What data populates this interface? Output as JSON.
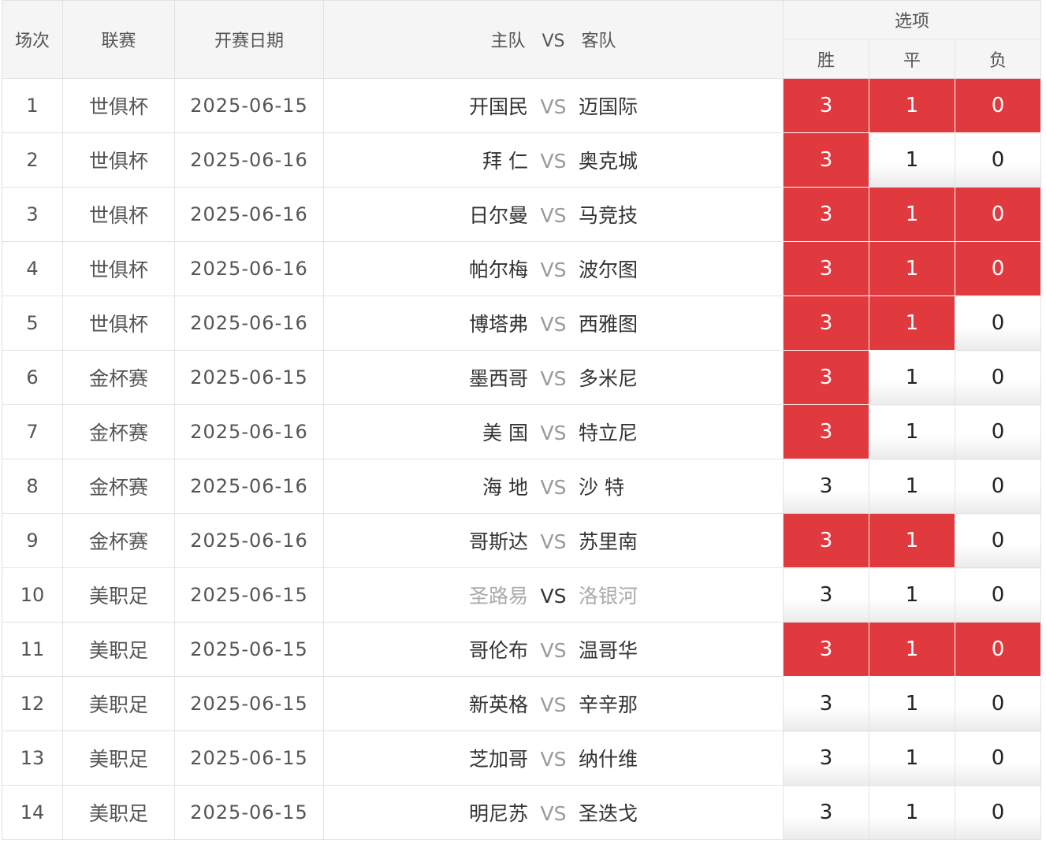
{
  "header": {
    "col_index": "场次",
    "col_league": "联赛",
    "col_date": "开赛日期",
    "col_home": "主队",
    "col_vs": "VS",
    "col_away": "客队",
    "col_options": "选项",
    "opt_win": "胜",
    "opt_draw": "平",
    "opt_lose": "负"
  },
  "accent_color": "#e0393e",
  "rows": [
    {
      "no": "1",
      "league": "世俱杯",
      "date": "2025-06-15",
      "home": "开国民",
      "vs": "VS",
      "away": "迈国际",
      "win": "3",
      "draw": "1",
      "lose": "0",
      "sel": [
        true,
        true,
        true
      ]
    },
    {
      "no": "2",
      "league": "世俱杯",
      "date": "2025-06-16",
      "home": "拜 仁",
      "vs": "VS",
      "away": "奥克城",
      "win": "3",
      "draw": "1",
      "lose": "0",
      "sel": [
        true,
        false,
        false
      ]
    },
    {
      "no": "3",
      "league": "世俱杯",
      "date": "2025-06-16",
      "home": "日尔曼",
      "vs": "VS",
      "away": "马竞技",
      "win": "3",
      "draw": "1",
      "lose": "0",
      "sel": [
        true,
        true,
        true
      ]
    },
    {
      "no": "4",
      "league": "世俱杯",
      "date": "2025-06-16",
      "home": "帕尔梅",
      "vs": "VS",
      "away": "波尔图",
      "win": "3",
      "draw": "1",
      "lose": "0",
      "sel": [
        true,
        true,
        true
      ]
    },
    {
      "no": "5",
      "league": "世俱杯",
      "date": "2025-06-16",
      "home": "博塔弗",
      "vs": "VS",
      "away": "西雅图",
      "win": "3",
      "draw": "1",
      "lose": "0",
      "sel": [
        true,
        true,
        false
      ]
    },
    {
      "no": "6",
      "league": "金杯赛",
      "date": "2025-06-15",
      "home": "墨西哥",
      "vs": "VS",
      "away": "多米尼",
      "win": "3",
      "draw": "1",
      "lose": "0",
      "sel": [
        true,
        false,
        false
      ]
    },
    {
      "no": "7",
      "league": "金杯赛",
      "date": "2025-06-16",
      "home": "美 国",
      "vs": "VS",
      "away": "特立尼",
      "win": "3",
      "draw": "1",
      "lose": "0",
      "sel": [
        true,
        false,
        false
      ]
    },
    {
      "no": "8",
      "league": "金杯赛",
      "date": "2025-06-16",
      "home": "海 地",
      "vs": "VS",
      "away": "沙 特",
      "win": "3",
      "draw": "1",
      "lose": "0",
      "sel": [
        false,
        false,
        false
      ]
    },
    {
      "no": "9",
      "league": "金杯赛",
      "date": "2025-06-16",
      "home": "哥斯达",
      "vs": "VS",
      "away": "苏里南",
      "win": "3",
      "draw": "1",
      "lose": "0",
      "sel": [
        true,
        true,
        false
      ]
    },
    {
      "no": "10",
      "league": "美职足",
      "date": "2025-06-15",
      "home": "圣路易",
      "vs": "VS",
      "away": "洛银河",
      "win": "3",
      "draw": "1",
      "lose": "0",
      "sel": [
        false,
        false,
        false
      ],
      "muted": true
    },
    {
      "no": "11",
      "league": "美职足",
      "date": "2025-06-15",
      "home": "哥伦布",
      "vs": "VS",
      "away": "温哥华",
      "win": "3",
      "draw": "1",
      "lose": "0",
      "sel": [
        true,
        true,
        true
      ]
    },
    {
      "no": "12",
      "league": "美职足",
      "date": "2025-06-15",
      "home": "新英格",
      "vs": "VS",
      "away": "辛辛那",
      "win": "3",
      "draw": "1",
      "lose": "0",
      "sel": [
        false,
        false,
        false
      ]
    },
    {
      "no": "13",
      "league": "美职足",
      "date": "2025-06-15",
      "home": "芝加哥",
      "vs": "VS",
      "away": "纳什维",
      "win": "3",
      "draw": "1",
      "lose": "0",
      "sel": [
        false,
        false,
        false
      ]
    },
    {
      "no": "14",
      "league": "美职足",
      "date": "2025-06-15",
      "home": "明尼苏",
      "vs": "VS",
      "away": "圣迭戈",
      "win": "3",
      "draw": "1",
      "lose": "0",
      "sel": [
        false,
        false,
        false
      ]
    }
  ]
}
